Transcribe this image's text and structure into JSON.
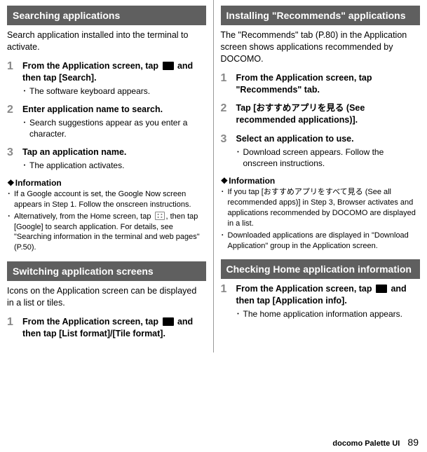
{
  "left": {
    "searching": {
      "header": "Searching applications",
      "intro": "Search application installed into the terminal to activate.",
      "steps": [
        {
          "num": "1",
          "title_pre": "From the Application screen, tap ",
          "title_post": " and then tap [Search].",
          "bullets": [
            "The software keyboard appears."
          ]
        },
        {
          "num": "2",
          "title": "Enter application name to search.",
          "bullets": [
            "Search suggestions appear as you enter a character."
          ]
        },
        {
          "num": "3",
          "title": "Tap an application name.",
          "bullets": [
            "The application activates."
          ]
        }
      ],
      "info_head": "Information",
      "info": [
        "If a Google account is set, the Google Now screen appears in Step 1. Follow the onscreen instructions.",
        "Alternatively, from the Home screen, tap [grid], then tap [Google] to search application. For details, see \"Searching information in the terminal and web pages\" (P.50)."
      ]
    },
    "switching": {
      "header": "Switching application screens",
      "intro": "Icons on the Application screen can be displayed in a list or tiles.",
      "steps": [
        {
          "num": "1",
          "title_pre": "From the Application screen, tap ",
          "title_post": " and then tap [List format]/[Tile format]."
        }
      ]
    }
  },
  "right": {
    "installing": {
      "header": "Installing \"Recommends\" applications",
      "intro": "The \"Recommends\" tab (P.80) in the Application screen shows applications recommended by DOCOMO.",
      "steps": [
        {
          "num": "1",
          "title": "From the Application screen, tap \"Recommends\" tab."
        },
        {
          "num": "2",
          "title": "Tap [おすすめアプリを見る (See recommended applications)]."
        },
        {
          "num": "3",
          "title": "Select an application to use.",
          "bullets": [
            "Download screen appears. Follow the onscreen instructions."
          ]
        }
      ],
      "info_head": "Information",
      "info": [
        "If you tap [おすすめアプリをすべて見る (See all recommended apps)] in Step 3, Browser activates and applications recommended by DOCOMO are displayed in a list.",
        "Downloaded applications are displayed in \"Download Application\" group in the Application screen."
      ]
    },
    "checking": {
      "header": "Checking Home application information",
      "steps": [
        {
          "num": "1",
          "title_pre": "From the Application screen, tap ",
          "title_post": " and then tap [Application info].",
          "bullets": [
            "The home application information appears."
          ]
        }
      ]
    }
  },
  "footer": {
    "label": "docomo Palette UI",
    "page": "89"
  },
  "glyphs": {
    "dot": "･",
    "diamond": "❖"
  }
}
